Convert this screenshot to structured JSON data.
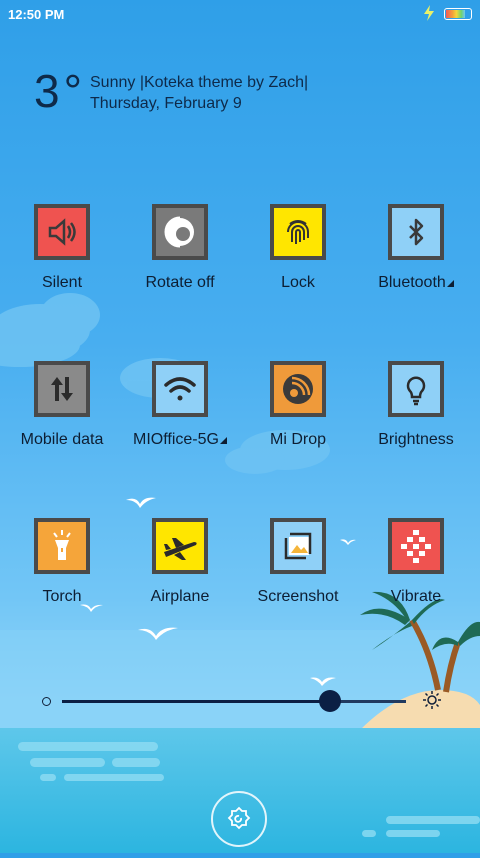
{
  "status_bar": {
    "time": "12:50 PM",
    "battery_level": 0.8
  },
  "weather": {
    "temperature": "3°",
    "condition_line": "Sunny  |Koteka theme by Zach|",
    "date_line": "Thursday, February 9"
  },
  "toggles": [
    {
      "label": "Silent",
      "icon": "speaker-icon",
      "color": "#ef5350"
    },
    {
      "label": "Rotate off",
      "icon": "rotate-icon",
      "color": "#7a7a7a"
    },
    {
      "label": "Lock",
      "icon": "fingerprint-icon",
      "color": "#ffe600"
    },
    {
      "label": "Bluetooth",
      "icon": "bluetooth-icon",
      "color": "#8fd0f7",
      "has_submenu": true
    },
    {
      "label": "Mobile data",
      "icon": "mobile-data-icon",
      "color": "#8a8a8a"
    },
    {
      "label": "MIOffice-5G",
      "icon": "wifi-icon",
      "color": "#8fd0f7",
      "has_submenu": true
    },
    {
      "label": "Mi Drop",
      "icon": "mi-drop-icon",
      "color": "#ef9a3a"
    },
    {
      "label": "Brightness",
      "icon": "bulb-icon",
      "color": "#8fd0f7"
    },
    {
      "label": "Torch",
      "icon": "torch-icon",
      "color": "#f5a53a"
    },
    {
      "label": "Airplane",
      "icon": "airplane-icon",
      "color": "#ffe600"
    },
    {
      "label": "Screenshot",
      "icon": "screenshot-icon",
      "color": "#8fd0f7"
    },
    {
      "label": "Vibrate",
      "icon": "vibrate-icon",
      "color": "#ef5350"
    }
  ],
  "brightness_slider": {
    "value": 0.78
  }
}
